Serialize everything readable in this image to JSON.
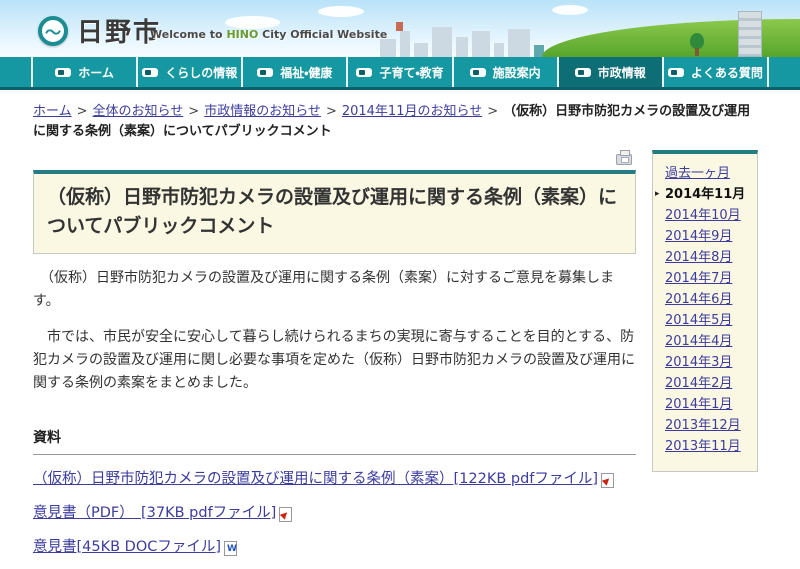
{
  "header": {
    "site_name": "日野市",
    "welcome_pre": "Welcome to ",
    "welcome_hino": "HINO",
    "welcome_post": " City Official Website"
  },
  "nav": {
    "items": [
      {
        "label": "ホーム",
        "active": false
      },
      {
        "label": "くらしの情報",
        "active": false
      },
      {
        "label": "福祉・健康",
        "active": false
      },
      {
        "label": "子育て・教育",
        "active": false
      },
      {
        "label": "施設案内",
        "active": false
      },
      {
        "label": "市政情報",
        "active": true
      },
      {
        "label": "よくある質問",
        "active": false
      }
    ]
  },
  "breadcrumb": {
    "separator": ">",
    "links": [
      "ホーム",
      "全体のお知らせ",
      "市政情報のお知らせ",
      "2014年11月のお知らせ"
    ],
    "current": "（仮称）日野市防犯カメラの設置及び運用に関する条例（素案）についてパブリックコメント"
  },
  "main": {
    "title": "（仮称）日野市防犯カメラの設置及び運用に関する条例（素案）についてパブリックコメント",
    "paragraphs": [
      "　（仮称）日野市防犯カメラの設置及び運用に関する条例（素案）に対するご意見を募集します。",
      "　市では、市民が安全に安心して暮らし続けられるまちの実現に寄与することを目的とする、防犯カメラの設置及び運用に関し必要な事項を定めた（仮称）日野市防犯カメラの設置及び運用に関する条例の素案をまとめました。"
    ],
    "attachments_heading": "資料",
    "attachments": [
      {
        "label": "（仮称）日野市防犯カメラの設置及び運用に関する条例（素案）[122KB pdfファイル]",
        "icon": "pdf-icon"
      },
      {
        "label": "意見書（PDF）　[37KB pdfファイル]",
        "icon": "pdf-icon"
      },
      {
        "label": "意見書[45KB DOCファイル]",
        "icon": "doc-icon"
      }
    ]
  },
  "sidebar": {
    "top_link": "過去一ヶ月",
    "current_marker": "▸",
    "current_month": "2014年11月",
    "months": [
      "2014年10月",
      "2014年9月",
      "2014年8月",
      "2014年7月",
      "2014年6月",
      "2014年5月",
      "2014年4月",
      "2014年3月",
      "2014年2月",
      "2014年1月",
      "2013年12月",
      "2013年11月"
    ]
  },
  "icons": {
    "logo_wave": "～"
  },
  "colors": {
    "nav_teal": "#1698a2",
    "nav_active": "#0d6e76",
    "nav_bottom_edge": "#0b616b",
    "box_accent_teal": "#257d84",
    "box_cream": "#faf7e3",
    "link_blue": "#3c3c9e",
    "hill_green": "#57a52c",
    "sky_blue": "#b9e2f8"
  }
}
